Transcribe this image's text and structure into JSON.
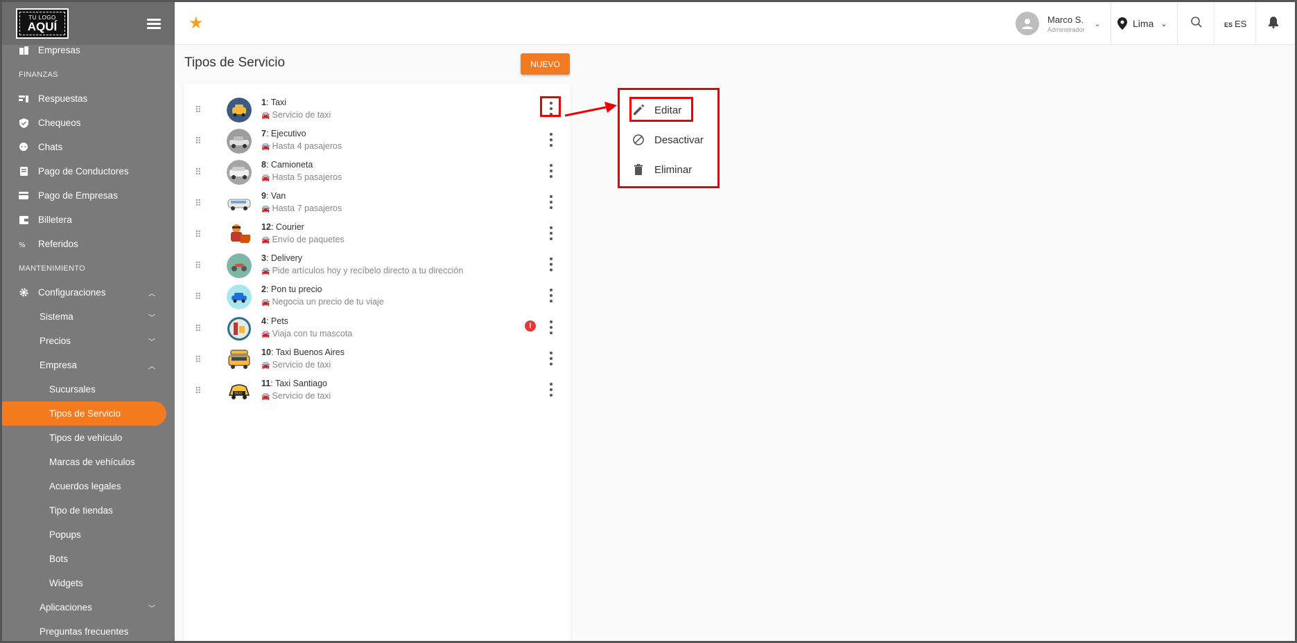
{
  "logo": {
    "line1": "TU LOGO",
    "line2": "AQUÍ"
  },
  "sidebar": {
    "items": [
      {
        "label": "Empresas",
        "icon": "building-icon",
        "type": "item"
      },
      {
        "label": "FINANZAS",
        "type": "section"
      },
      {
        "label": "Respuestas",
        "icon": "responses-icon",
        "type": "item"
      },
      {
        "label": "Chequeos",
        "icon": "shield-check-icon",
        "type": "item"
      },
      {
        "label": "Chats",
        "icon": "chat-icon",
        "type": "item"
      },
      {
        "label": "Pago de Conductores",
        "icon": "document-icon",
        "type": "item"
      },
      {
        "label": "Pago de Empresas",
        "icon": "card-icon",
        "type": "item"
      },
      {
        "label": "Billetera",
        "icon": "wallet-icon",
        "type": "item"
      },
      {
        "label": "Referidos",
        "icon": "referral-icon",
        "type": "item"
      },
      {
        "label": "MANTENIMIENTO",
        "type": "section"
      },
      {
        "label": "Configuraciones",
        "icon": "gear-icon",
        "type": "item"
      },
      {
        "label": "Sistema",
        "type": "sub"
      },
      {
        "label": "Precios",
        "type": "sub"
      },
      {
        "label": "Empresa",
        "type": "sub"
      },
      {
        "label": "Sucursales",
        "type": "sub2"
      },
      {
        "label": "Tipos de Servicio",
        "type": "sub2"
      },
      {
        "label": "Tipos de vehículo",
        "type": "sub2"
      },
      {
        "label": "Marcas de vehículos",
        "type": "sub2"
      },
      {
        "label": "Acuerdos legales",
        "type": "sub2"
      },
      {
        "label": "Tipo de tiendas",
        "type": "sub2"
      },
      {
        "label": "Popups",
        "type": "sub2"
      },
      {
        "label": "Bots",
        "type": "sub2"
      },
      {
        "label": "Widgets",
        "type": "sub2"
      },
      {
        "label": "Aplicaciones",
        "type": "sub"
      },
      {
        "label": "Preguntas frecuentes",
        "type": "sub"
      }
    ]
  },
  "topbar": {
    "user_name": "Marco S.",
    "user_role": "Adminstrador",
    "city": "Lima",
    "lang_flag": "ES",
    "lang": "ES"
  },
  "page": {
    "title": "Tipos de Servicio",
    "new_button": "NUEVO"
  },
  "services": [
    {
      "id": "1",
      "name": "Taxi",
      "desc": "Servicio de taxi"
    },
    {
      "id": "7",
      "name": "Ejecutivo",
      "desc": "Hasta 4 pasajeros"
    },
    {
      "id": "8",
      "name": "Camioneta",
      "desc": "Hasta 5 pasajeros"
    },
    {
      "id": "9",
      "name": "Van",
      "desc": "Hasta 7 pasajeros"
    },
    {
      "id": "12",
      "name": "Courier",
      "desc": "Envío de paquetes"
    },
    {
      "id": "3",
      "name": "Delivery",
      "desc": "Pide artículos hoy y recíbelo directo a tu dirección"
    },
    {
      "id": "2",
      "name": "Pon tu precio",
      "desc": "Negocia un precio de tu viaje"
    },
    {
      "id": "4",
      "name": "Pets",
      "desc": "Viaja con tu mascota"
    },
    {
      "id": "10",
      "name": "Taxi Buenos Aires",
      "desc": "Servicio de taxi"
    },
    {
      "id": "11",
      "name": "Taxi Santiago",
      "desc": "Servicio de taxi"
    }
  ],
  "menu": {
    "edit": "Editar",
    "deactivate": "Desactivar",
    "delete": "Eliminar"
  },
  "colors": {
    "accent": "#f47a20",
    "sidebar": "#7a7a7a",
    "highlight": "#e00000",
    "star": "#f4a21d"
  }
}
